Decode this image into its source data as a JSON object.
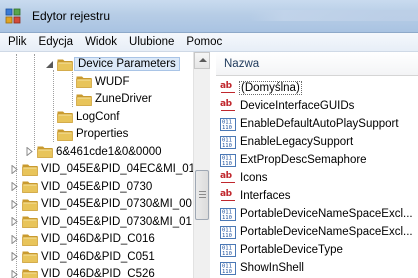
{
  "window": {
    "title": "Edytor rejestru"
  },
  "menu": [
    "Plik",
    "Edycja",
    "Widok",
    "Ulubione",
    "Pomoc"
  ],
  "tree": {
    "items": [
      {
        "label": "Device Parameters",
        "level": 2,
        "selected": true,
        "expander": "open"
      },
      {
        "label": "WUDF",
        "level": 3,
        "selected": false,
        "expander": "none"
      },
      {
        "label": "ZuneDriver",
        "level": 3,
        "selected": false,
        "expander": "none"
      },
      {
        "label": "LogConf",
        "level": 2,
        "selected": false,
        "expander": "none"
      },
      {
        "label": "Properties",
        "level": 2,
        "selected": false,
        "expander": "none"
      },
      {
        "label": "6&461cde1&0&0000",
        "level": 1,
        "selected": false,
        "expander": "closed"
      },
      {
        "label": "VID_045E&PID_04EC&MI_01",
        "level": 0,
        "selected": false,
        "expander": "closed"
      },
      {
        "label": "VID_045E&PID_0730",
        "level": 0,
        "selected": false,
        "expander": "closed"
      },
      {
        "label": "VID_045E&PID_0730&MI_00",
        "level": 0,
        "selected": false,
        "expander": "closed"
      },
      {
        "label": "VID_045E&PID_0730&MI_01",
        "level": 0,
        "selected": false,
        "expander": "closed"
      },
      {
        "label": "VID_046D&PID_C016",
        "level": 0,
        "selected": false,
        "expander": "closed"
      },
      {
        "label": "VID_046D&PID_C051",
        "level": 0,
        "selected": false,
        "expander": "closed"
      },
      {
        "label": "VID_046D&PID_C526",
        "level": 0,
        "selected": false,
        "expander": "closed"
      }
    ]
  },
  "values": {
    "column_header": "Nazwa",
    "items": [
      {
        "name": "(Domyślna)",
        "type": "string",
        "selected": true
      },
      {
        "name": "DeviceInterfaceGUIDs",
        "type": "string",
        "selected": false
      },
      {
        "name": "EnableDefaultAutoPlaySupport",
        "type": "binary",
        "selected": false
      },
      {
        "name": "EnableLegacySupport",
        "type": "binary",
        "selected": false
      },
      {
        "name": "ExtPropDescSemaphore",
        "type": "binary",
        "selected": false
      },
      {
        "name": "Icons",
        "type": "string",
        "selected": false
      },
      {
        "name": "Interfaces",
        "type": "string",
        "selected": false
      },
      {
        "name": "PortableDeviceNameSpaceExcl...",
        "type": "binary",
        "selected": false
      },
      {
        "name": "PortableDeviceNameSpaceExcl...",
        "type": "binary",
        "selected": false
      },
      {
        "name": "PortableDeviceType",
        "type": "binary",
        "selected": false
      },
      {
        "name": "ShowInShell",
        "type": "binary",
        "selected": false
      }
    ]
  },
  "colors": {
    "folder": "#e8c45a",
    "folder_dark": "#c99a2e",
    "string_icon": "#c0272d",
    "binary_icon": "#1b4f9c",
    "selection": "#dce9f8"
  }
}
